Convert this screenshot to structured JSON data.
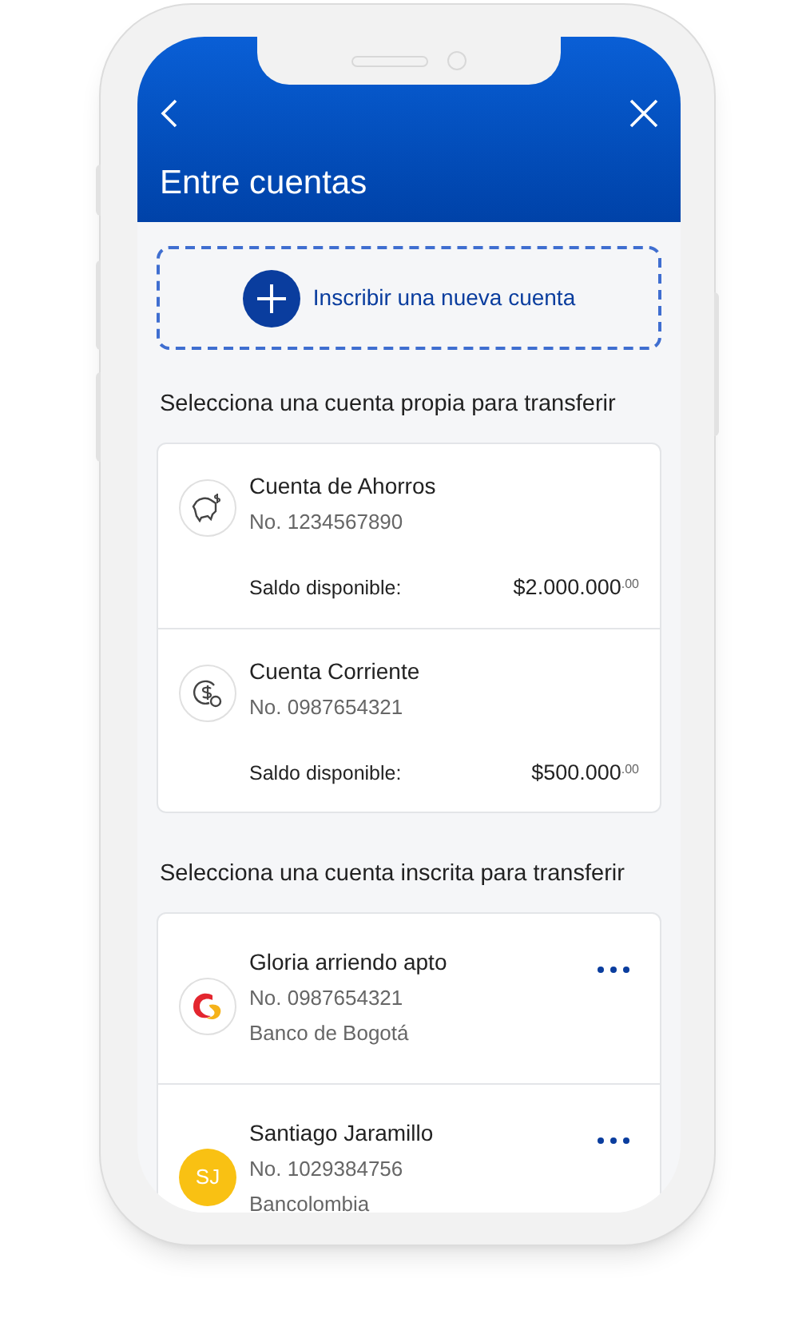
{
  "header": {
    "title": "Entre cuentas"
  },
  "add_account": {
    "label": "Inscribir una nueva cuenta"
  },
  "own_section": {
    "title": "Selecciona una cuenta propia para transferir",
    "accounts": [
      {
        "kind": "piggy",
        "name": "Cuenta de Ahorros",
        "number": "No. 1234567890",
        "balance_label": "Saldo disponible:",
        "balance": "$2.000.000$^{.00}$"
      },
      {
        "kind": "coin",
        "name": "Cuenta Corriente",
        "number": "No. 0987654321",
        "balance_label": "Saldo disponible:",
        "balance": "$500.000$^{.00}$"
      }
    ]
  },
  "enrolled_section": {
    "title": "Selecciona una cuenta inscrita para transferir",
    "accounts": [
      {
        "kind": "logo",
        "name": "Gloria arriendo apto",
        "number": "No. 0987654321",
        "bank": "Banco de Bogotá"
      },
      {
        "kind": "initials",
        "initials": "SJ",
        "color": "#f9c113",
        "name": "Santiago Jaramillo",
        "number": "No. 1029384756",
        "bank": "Bancolombia"
      }
    ]
  }
}
